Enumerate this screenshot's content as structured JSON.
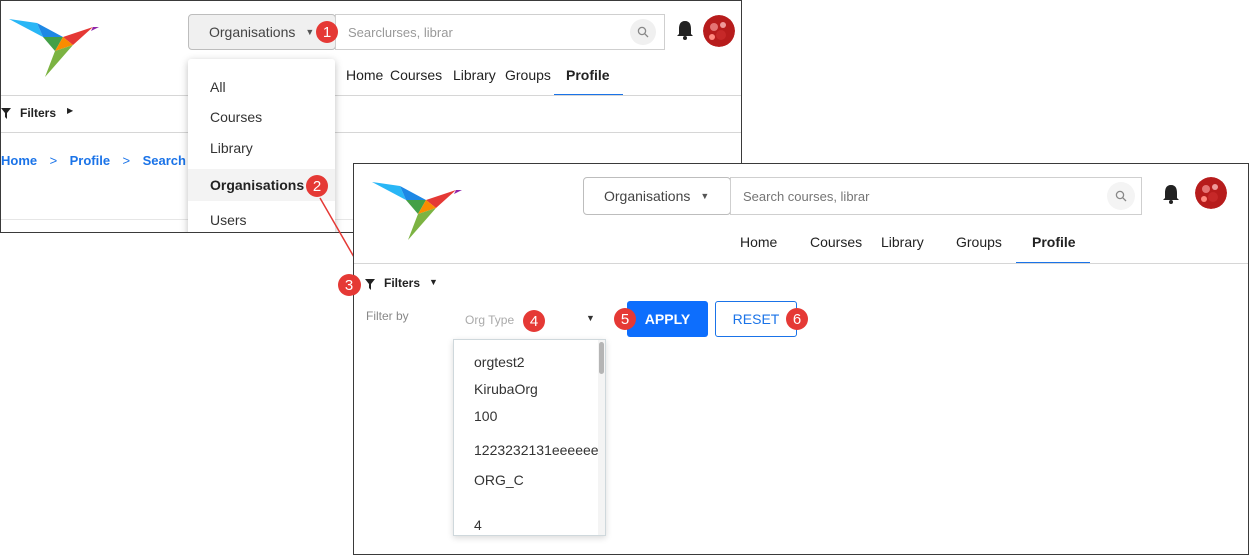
{
  "screen1": {
    "org_button_label": "Organisations",
    "search_placeholder": "Searcl",
    "search_placeholder_rest": "urses, librar",
    "nav": [
      "Home",
      "Courses",
      "Library",
      "Groups",
      "Profile"
    ],
    "active_nav": "Profile",
    "filters_label": "Filters",
    "dropdown_items": [
      "All",
      "Courses",
      "Library",
      "Organisations",
      "Users"
    ],
    "selected_item": "Organisations",
    "breadcrumb": [
      "Home",
      "Profile",
      "Search"
    ]
  },
  "screen2": {
    "org_button_label": "Organisations",
    "search_placeholder": "Search courses, librar",
    "nav": [
      "Home",
      "Courses",
      "Library",
      "Groups",
      "Profile"
    ],
    "active_nav": "Profile",
    "filters_label": "Filters",
    "filter_by_label": "Filter by",
    "org_type_placeholder": "Org Type",
    "apply_label": "APPLY",
    "reset_label": "RESET",
    "org_type_options": [
      "orgtest2",
      "KirubaOrg",
      "100",
      "1223232131eeeeeee",
      "ORG_C",
      "",
      "4"
    ]
  },
  "callouts": [
    "1",
    "2",
    "3",
    "4",
    "5",
    "6"
  ],
  "colors": {
    "accent_blue": "#1a73e8",
    "apply_blue": "#0d6efd",
    "callout_red": "#e53935",
    "active_tab_underline": "#1a73e8"
  },
  "icons": [
    "hummingbird-logo",
    "chevron-down-icon",
    "search-icon",
    "bell-icon",
    "avatar",
    "filter-icon",
    "caret-right-icon",
    "breadcrumb-chevron-icon",
    "arrow-connector"
  ]
}
